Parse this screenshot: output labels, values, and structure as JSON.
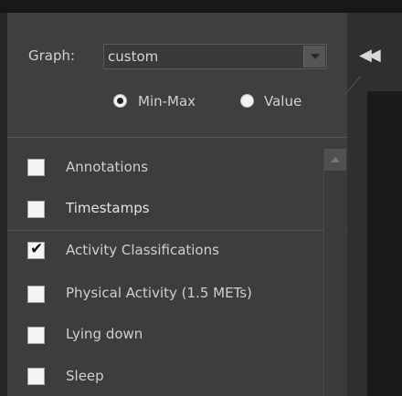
{
  "window": {
    "title": "— — —"
  },
  "graph": {
    "label": "Graph:",
    "value": "custom"
  },
  "collapse": {
    "icon": "double-chevron-left-icon",
    "glyph": "◀◀"
  },
  "mode": {
    "options": [
      {
        "label": "Min-Max",
        "checked": true
      },
      {
        "label": "Value",
        "checked": false
      }
    ]
  },
  "items": [
    {
      "label": "Annotations",
      "checked": false
    },
    {
      "label": "Timestamps",
      "checked": false
    },
    {
      "label": "Activity Classifications",
      "checked": true
    },
    {
      "label": "Physical Activity (1.5 METs)",
      "checked": false
    },
    {
      "label": "Lying down",
      "checked": false
    },
    {
      "label": "Sleep",
      "checked": false
    }
  ],
  "colors": {
    "panel": "#3d3d3d",
    "text": "#cfcfcf",
    "background": "#1e1e1e"
  }
}
